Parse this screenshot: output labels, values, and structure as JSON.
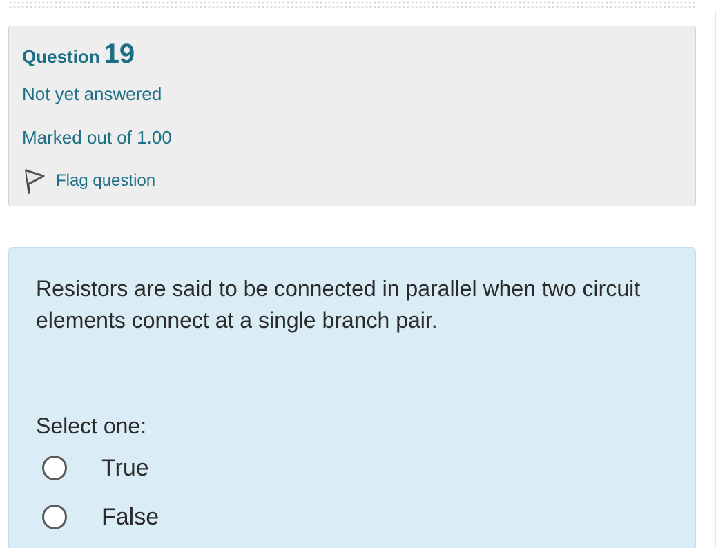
{
  "question_info": {
    "question_word": "Question",
    "question_number": "19",
    "state": "Not yet answered",
    "grade": "Marked out of 1.00",
    "flag_label": "Flag question"
  },
  "question": {
    "text": "Resistors are said to be connected in parallel when two circuit elements connect at a single branch pair.",
    "prompt": "Select one:",
    "options": [
      {
        "label": "True",
        "selected": false
      },
      {
        "label": "False",
        "selected": false
      }
    ]
  },
  "icons": {
    "flag": "flag-icon",
    "radio": "radio-button"
  },
  "colors": {
    "accent": "#1d6f86",
    "info_background": "#eeeeee",
    "content_background": "#daedf7",
    "text": "#2b2b2b"
  }
}
